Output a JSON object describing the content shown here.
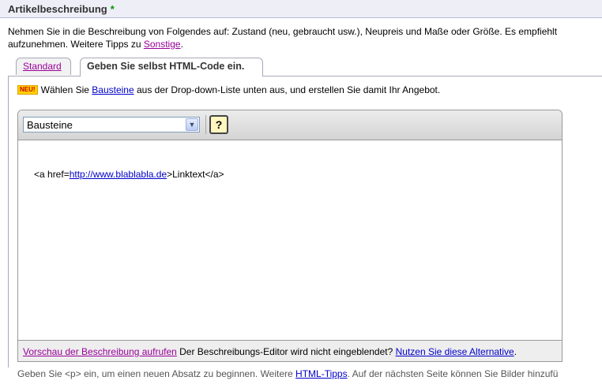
{
  "section": {
    "title": "Artikelbeschreibung",
    "required_marker": "*"
  },
  "intro": {
    "line1": "Nehmen Sie in die Beschreibung von Folgendes auf: Zustand (neu, gebraucht usw.), Neupreis und Maße oder Größe. Es empfiehlt",
    "line2_prefix": "aufzunehmen. Weitere Tipps zu ",
    "line2_link": "Sonstige",
    "line2_suffix": "."
  },
  "tabs": [
    {
      "label": "Standard"
    },
    {
      "label": "Geben Sie selbst HTML-Code ein."
    }
  ],
  "hint": {
    "badge": "NEU!",
    "prefix": "Wählen Sie ",
    "link": "Bausteine",
    "suffix": " aus der Drop-down-Liste unten aus, und erstellen Sie damit Ihr Angebot."
  },
  "editor": {
    "select_value": "Bausteine",
    "help_label": "?",
    "code_prefix": "<a href=",
    "code_link": "http://www.blablabla.de",
    "code_suffix": ">Linktext</a>"
  },
  "footer": {
    "preview_link": "Vorschau der Beschreibung aufrufen",
    "middle_text": " Der Beschreibungs-Editor wird nicht eingeblendet? ",
    "alt_link": "Nutzen Sie diese Alternative",
    "end": "."
  },
  "bottom_note": {
    "prefix": "Geben Sie <p> ein, um einen neuen Absatz zu beginnen. Weitere ",
    "link": "HTML-Tipps",
    "suffix": ". Auf der nächsten Seite können Sie Bilder hinzufü"
  },
  "colors": {
    "link": "#0000cc",
    "visited_link": "#990099",
    "required": "#009900",
    "header_bg": "#eeeef7"
  }
}
